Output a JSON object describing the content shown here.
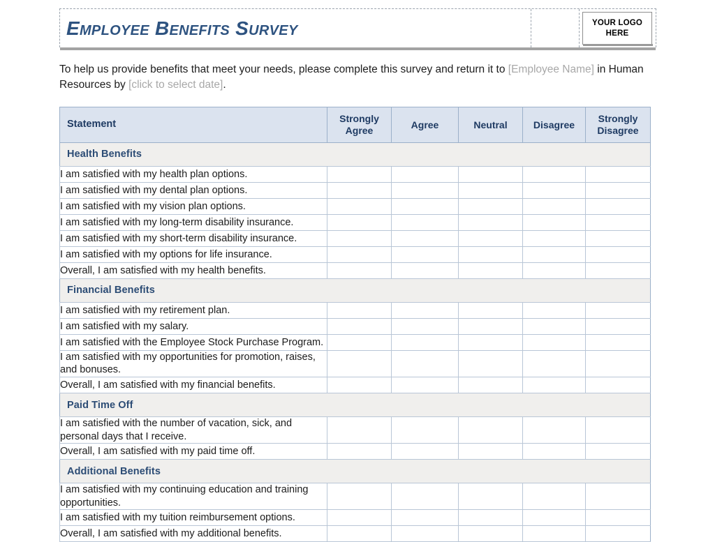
{
  "header": {
    "title": "Employee Benefits Survey",
    "logo_placeholder": "YOUR LOGO HERE"
  },
  "intro": {
    "part1": "To help us provide benefits that meet your needs, please complete this survey and return it to ",
    "employee_name_placeholder": "[Employee Name]",
    "part2": " in Human Resources by ",
    "date_placeholder": "[click to select date]",
    "part3": "."
  },
  "table": {
    "columns": [
      "Statement",
      "Strongly Agree",
      "Agree",
      "Neutral",
      "Disagree",
      "Strongly Disagree"
    ],
    "sections": [
      {
        "title": "Health Benefits",
        "items": [
          "I am satisfied with my health plan options.",
          "I am satisfied with my dental plan options.",
          "I am satisfied with my vision plan options.",
          "I am satisfied with my long-term disability insurance.",
          "I am satisfied with my short-term disability insurance.",
          "I am satisfied with my options for life insurance.",
          "Overall, I am satisfied with my health benefits."
        ]
      },
      {
        "title": "Financial Benefits",
        "items": [
          "I am satisfied with my retirement plan.",
          "I am satisfied with my salary.",
          "I am satisfied with the Employee Stock Purchase Program.",
          "I am satisfied with my opportunities for promotion, raises, and bonuses.",
          "Overall, I am satisfied with my financial benefits."
        ]
      },
      {
        "title": "Paid Time Off",
        "items": [
          "I am satisfied with the number of vacation, sick, and personal days that I receive.",
          "Overall, I am satisfied with my paid time off."
        ]
      },
      {
        "title": "Additional Benefits",
        "items": [
          "I am satisfied with my continuing education and training opportunities.",
          "I am satisfied with my tuition reimbursement options.",
          "Overall, I am satisfied with my additional benefits."
        ]
      }
    ]
  },
  "colors": {
    "title_blue": "#2e5380",
    "header_fill": "#dbe3ef",
    "header_text": "#1f3b63",
    "section_fill": "#f0efed",
    "section_text": "#2c4c75",
    "grid_line": "#b9c6d6",
    "placeholder_gray": "#a8a8a8"
  }
}
